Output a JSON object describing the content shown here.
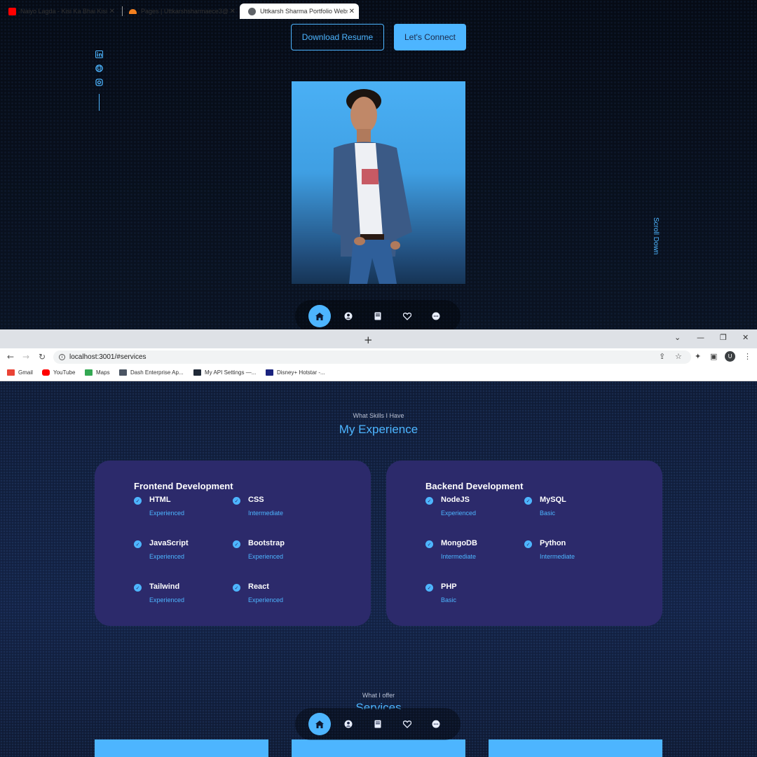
{
  "hero": {
    "download_resume": "Download Resume",
    "lets_connect": "Let's Connect",
    "scroll_down": "Scroll Down",
    "social_icons": [
      "linkedin-icon",
      "github-icon",
      "instagram-icon"
    ]
  },
  "nav": {
    "items": [
      "home-icon",
      "user-icon",
      "book-icon",
      "services-icon",
      "message-icon"
    ],
    "active": "home-icon"
  },
  "browser": {
    "tabs": [
      {
        "title": "Naiyo Lagda - Kisi Ka Bhai Kisi Ki",
        "favicon_color": "#ff0000"
      },
      {
        "title": "Pages | Uttkarshsharmaece3@gm",
        "favicon_color": "#f38020"
      },
      {
        "title": "Uttkarsh Sharma Portfolio Websi",
        "favicon_color": "#5f6368",
        "active": true
      }
    ],
    "url": "localhost:3001/#services",
    "avatar": "U",
    "bookmarks": [
      {
        "label": "Gmail",
        "color": "#ea4335"
      },
      {
        "label": "YouTube",
        "color": "#ff0000"
      },
      {
        "label": "Maps",
        "color": "#34a853"
      },
      {
        "label": "Dash Enterprise Ap...",
        "color": "#4b5563"
      },
      {
        "label": "My API Settings —...",
        "color": "#1f2937"
      },
      {
        "label": "Disney+ Hotstar -...",
        "color": "#1a237e"
      }
    ]
  },
  "experience": {
    "subtitle": "What Skills I Have",
    "title": "My Experience",
    "frontend": {
      "heading": "Frontend Development",
      "skills": [
        {
          "name": "HTML",
          "level": "Experienced"
        },
        {
          "name": "CSS",
          "level": "Intermediate"
        },
        {
          "name": "JavaScript",
          "level": "Experienced"
        },
        {
          "name": "Bootstrap",
          "level": "Experienced"
        },
        {
          "name": "Tailwind",
          "level": "Experienced"
        },
        {
          "name": "React",
          "level": "Experienced"
        }
      ]
    },
    "backend": {
      "heading": "Backend Development",
      "skills": [
        {
          "name": "NodeJS",
          "level": "Experienced"
        },
        {
          "name": "MySQL",
          "level": "Basic"
        },
        {
          "name": "MongoDB",
          "level": "Intermediate"
        },
        {
          "name": "Python",
          "level": "Intermediate"
        },
        {
          "name": "PHP",
          "level": "Basic"
        }
      ]
    }
  },
  "services": {
    "subtitle": "What I offer",
    "title": "Services"
  },
  "colors": {
    "accent": "#4db5ff",
    "card": "#2c2a6b"
  }
}
